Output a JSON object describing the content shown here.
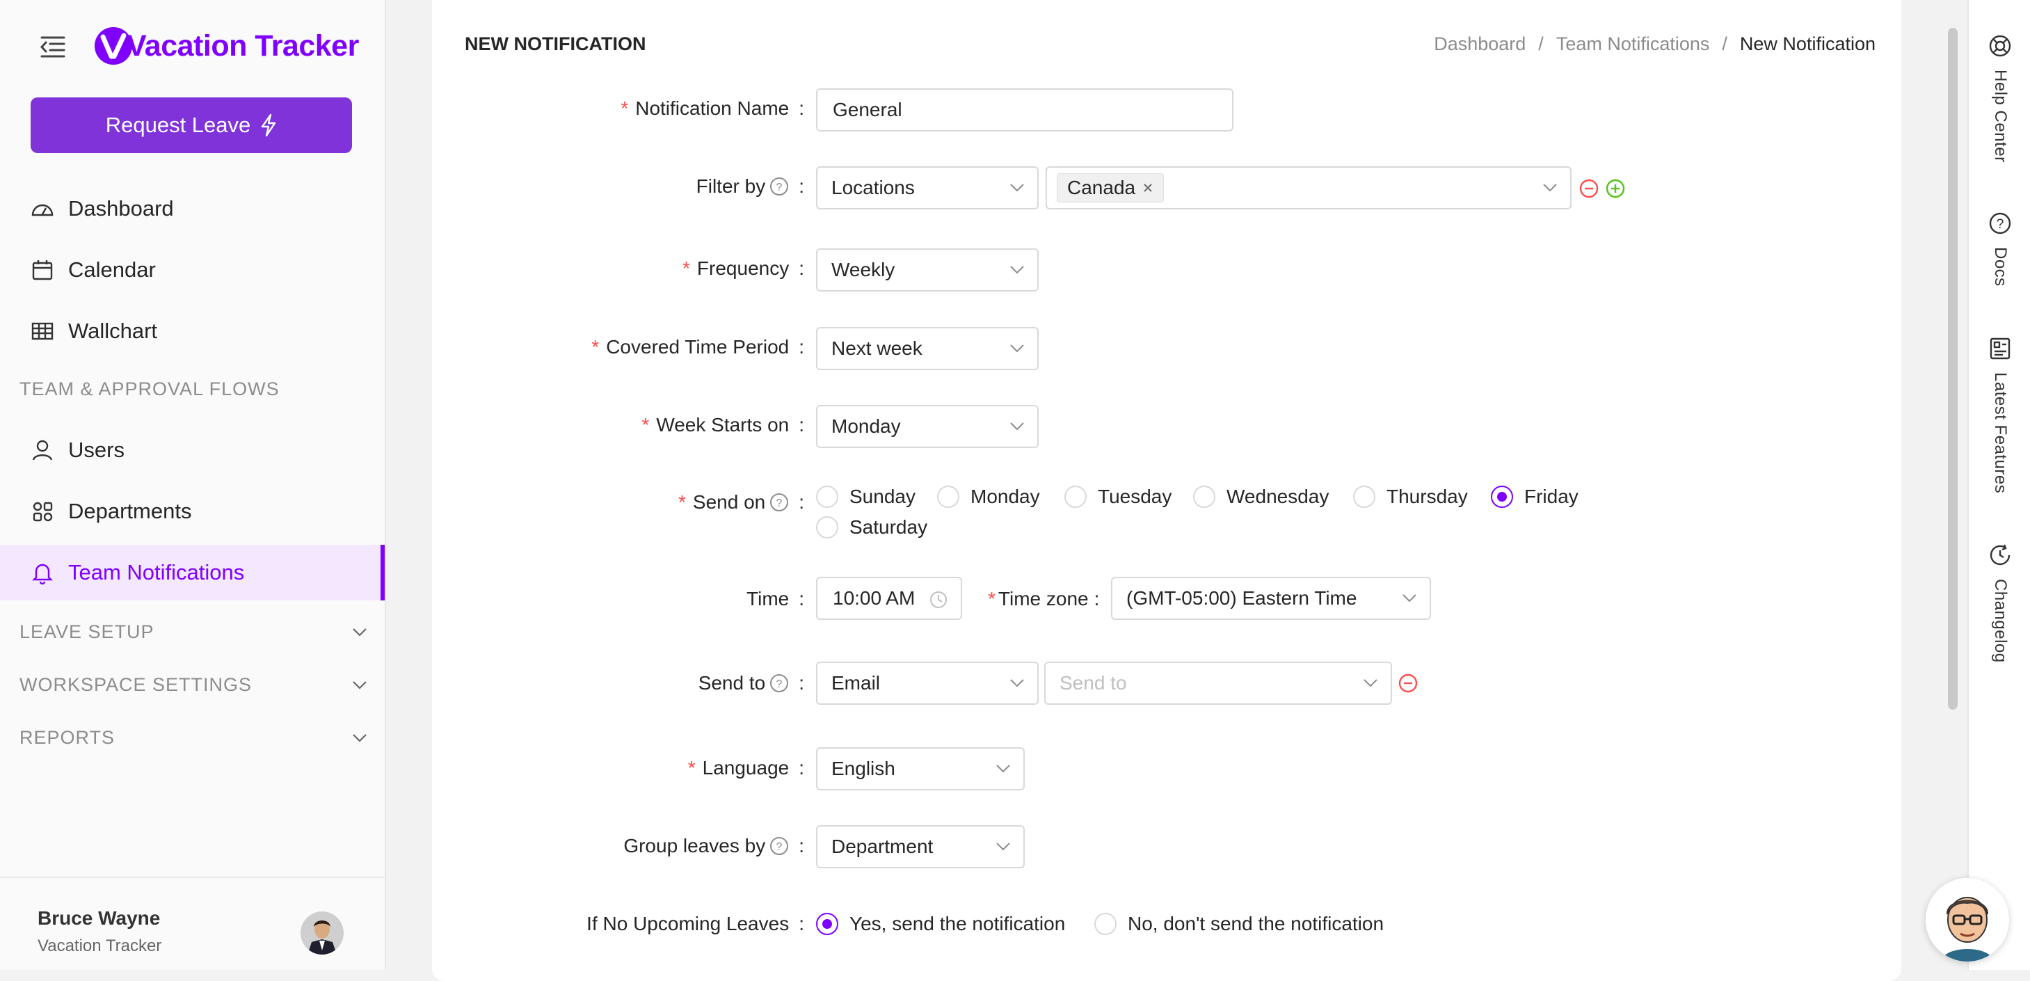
{
  "app": {
    "brand": "Vacation Tracker",
    "request_leave": "Request Leave"
  },
  "sidebar": {
    "items": [
      {
        "label": "Dashboard",
        "icon": "dashboard-icon"
      },
      {
        "label": "Calendar",
        "icon": "calendar-icon"
      },
      {
        "label": "Wallchart",
        "icon": "table-icon"
      }
    ],
    "section_team": "TEAM & APPROVAL FLOWS",
    "team_items": [
      {
        "label": "Users",
        "icon": "user-icon"
      },
      {
        "label": "Departments",
        "icon": "departments-icon"
      },
      {
        "label": "Team Notifications",
        "icon": "bell-icon",
        "active": true
      }
    ],
    "collapsibles": [
      "LEAVE SETUP",
      "WORKSPACE SETTINGS",
      "REPORTS"
    ]
  },
  "user": {
    "name": "Bruce Wayne",
    "company": "Vacation Tracker"
  },
  "page": {
    "title": "NEW NOTIFICATION",
    "breadcrumb": [
      "Dashboard",
      "Team Notifications",
      "New Notification"
    ]
  },
  "form": {
    "notification_name": {
      "label": "Notification Name",
      "value": "General"
    },
    "filter_by": {
      "label": "Filter by",
      "type": "Locations",
      "tags": [
        "Canada"
      ]
    },
    "frequency": {
      "label": "Frequency",
      "value": "Weekly"
    },
    "covered_period": {
      "label": "Covered Time Period",
      "value": "Next week"
    },
    "week_starts": {
      "label": "Week Starts on",
      "value": "Monday"
    },
    "send_on": {
      "label": "Send on",
      "options": [
        "Sunday",
        "Monday",
        "Tuesday",
        "Wednesday",
        "Thursday",
        "Friday",
        "Saturday"
      ],
      "selected": "Friday"
    },
    "time": {
      "label": "Time",
      "value": "10:00 AM"
    },
    "time_zone": {
      "label": "Time zone",
      "value": "(GMT-05:00) Eastern Time"
    },
    "send_to": {
      "label": "Send to",
      "channel": "Email",
      "placeholder": "Send to"
    },
    "language": {
      "label": "Language",
      "value": "English"
    },
    "group_by": {
      "label": "Group leaves by",
      "value": "Department"
    },
    "no_leaves": {
      "label": "If No Upcoming Leaves",
      "yes": "Yes, send the notification",
      "no": "No, don't send the notification",
      "selected": "yes"
    }
  },
  "rail": [
    "Help Center",
    "Docs",
    "Latest Features",
    "Changelog"
  ],
  "colors": {
    "accent": "#7f00ff",
    "button": "#7f33d9",
    "required": "#ff4d4f",
    "add": "#52c41a"
  }
}
